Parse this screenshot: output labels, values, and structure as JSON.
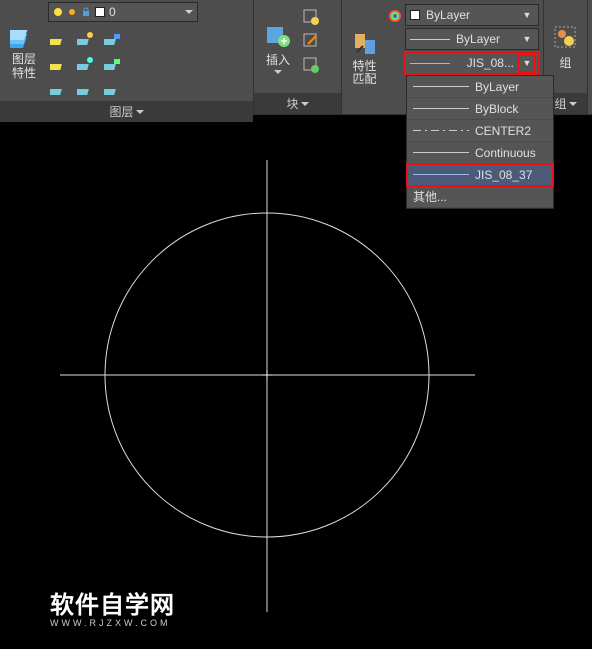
{
  "layers_panel": {
    "title": "图层",
    "big_button": "图层\n特性",
    "combo_value": "0"
  },
  "blocks_panel": {
    "title": "块",
    "big_button": "插入"
  },
  "properties_panel": {
    "big_button": "特性\n匹配",
    "color_combo": "ByLayer",
    "lineweight_combo": "ByLayer",
    "linetype_combo": "JIS_08...",
    "dropdown_items": [
      {
        "label": "ByLayer",
        "style": "line-solid"
      },
      {
        "label": "ByBlock",
        "style": "line-solid"
      },
      {
        "label": "CENTER2",
        "style": "line-center"
      },
      {
        "label": "Continuous",
        "style": "line-solid"
      },
      {
        "label": "JIS_08_37",
        "style": "line-jis"
      }
    ],
    "other_item": "其他..."
  },
  "group_panel": {
    "big_button": "组",
    "title": "组"
  },
  "watermark": {
    "main": "软件自学网",
    "sub": "WWW.RJZXW.COM"
  }
}
